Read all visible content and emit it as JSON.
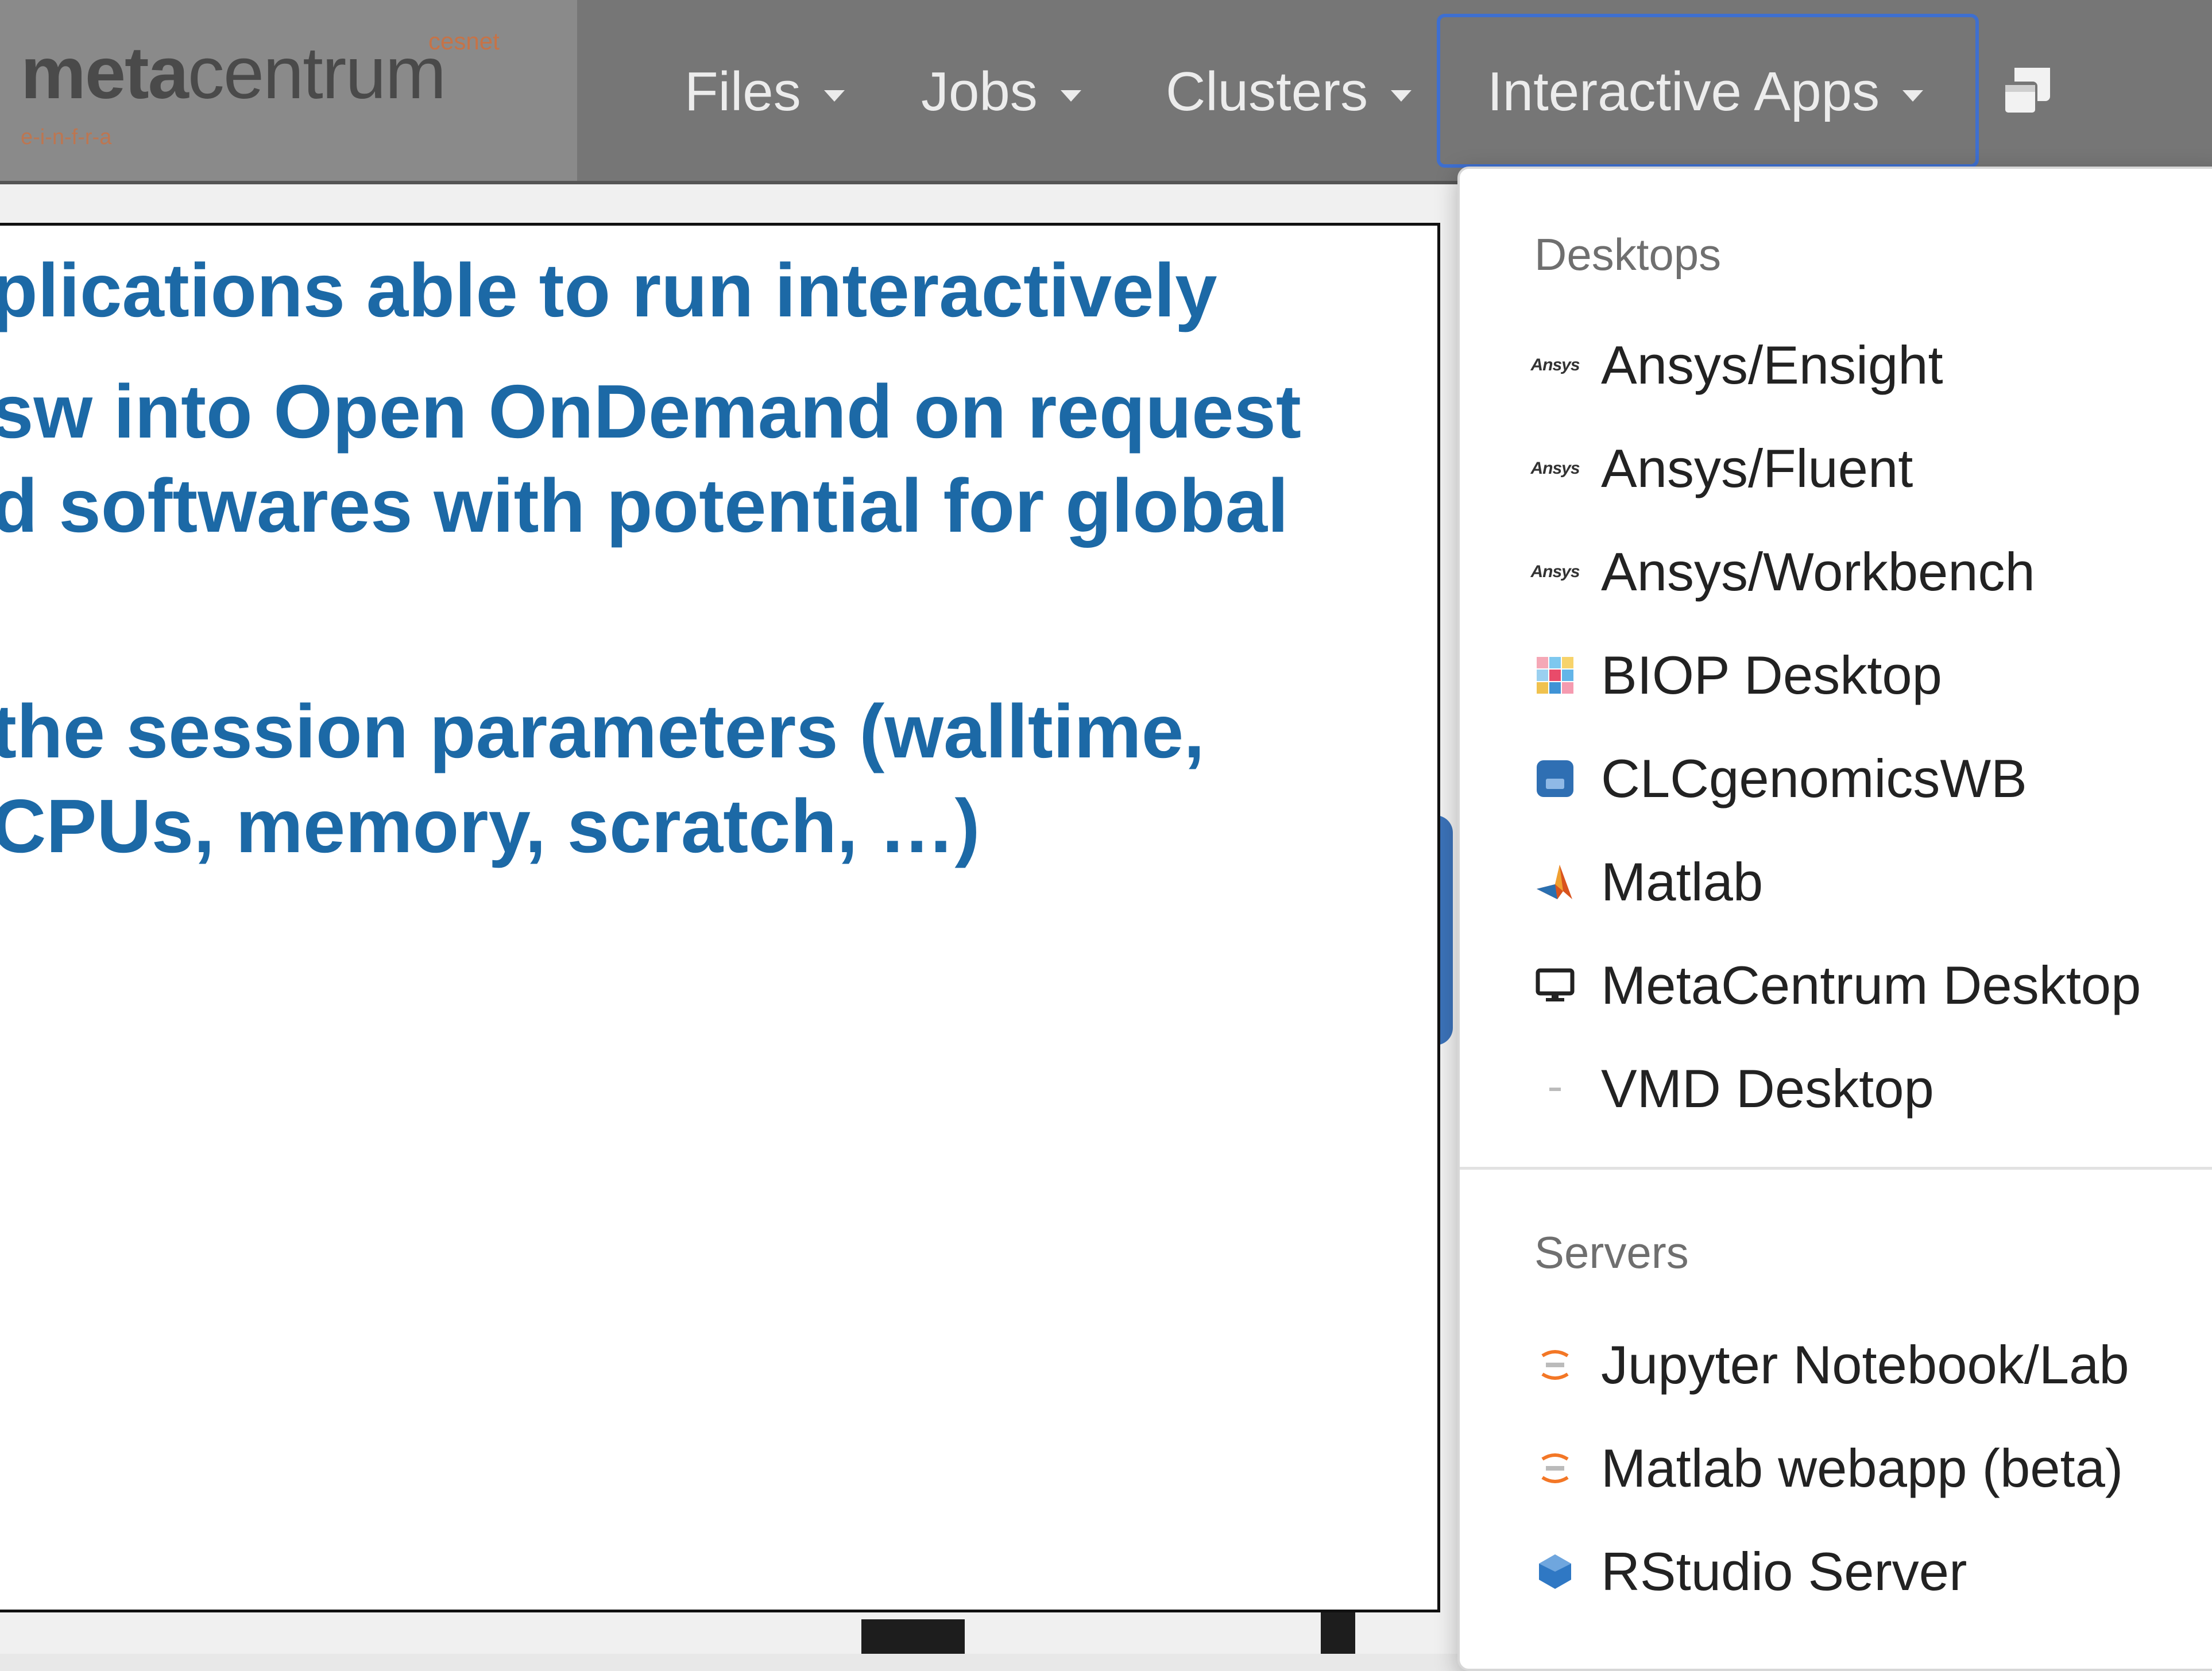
{
  "navbar": {
    "brand": {
      "bold": "meta",
      "rest": "centrum",
      "small": "cesnet",
      "sub": "e-i-n-f-r-a"
    },
    "items": [
      {
        "label": "Files"
      },
      {
        "label": "Jobs"
      },
      {
        "label": "Clusters"
      },
      {
        "label": "Interactive Apps"
      }
    ],
    "stack_icon": "windows-icon"
  },
  "slide": {
    "lines": [
      "plications able to run interactively",
      "sw into Open OnDemand on request",
      "d softwares with potential for global",
      " the session parameters (walltime,",
      "CPUs, memory, scratch, …)"
    ],
    "text_color": "#1c69a6"
  },
  "dropdown": {
    "desktops_header": "Desktops",
    "desktops": [
      {
        "label": "Ansys/Ensight",
        "icon": "ansys-icon"
      },
      {
        "label": "Ansys/Fluent",
        "icon": "ansys-icon"
      },
      {
        "label": "Ansys/Workbench",
        "icon": "ansys-icon"
      },
      {
        "label": "BIOP Desktop",
        "icon": "biop-icon"
      },
      {
        "label": "CLCgenomicsWB",
        "icon": "clc-icon"
      },
      {
        "label": "Matlab",
        "icon": "matlab-icon"
      },
      {
        "label": "MetaCentrum Desktop",
        "icon": "desktop-monitor-icon"
      },
      {
        "label": "VMD Desktop",
        "icon": "vmd-icon"
      }
    ],
    "servers_header": "Servers",
    "servers": [
      {
        "label": "Jupyter Notebook/Lab",
        "icon": "jupyter-icon"
      },
      {
        "label": "Matlab webapp (beta)",
        "icon": "jupyter-icon"
      },
      {
        "label": "RStudio Server",
        "icon": "rstudio-icon"
      }
    ],
    "ansys_icon_text": "Ansys"
  },
  "colors": {
    "navbar": "#767676",
    "active_outline": "#3e6fd0",
    "slide_text": "#1c69a6"
  }
}
